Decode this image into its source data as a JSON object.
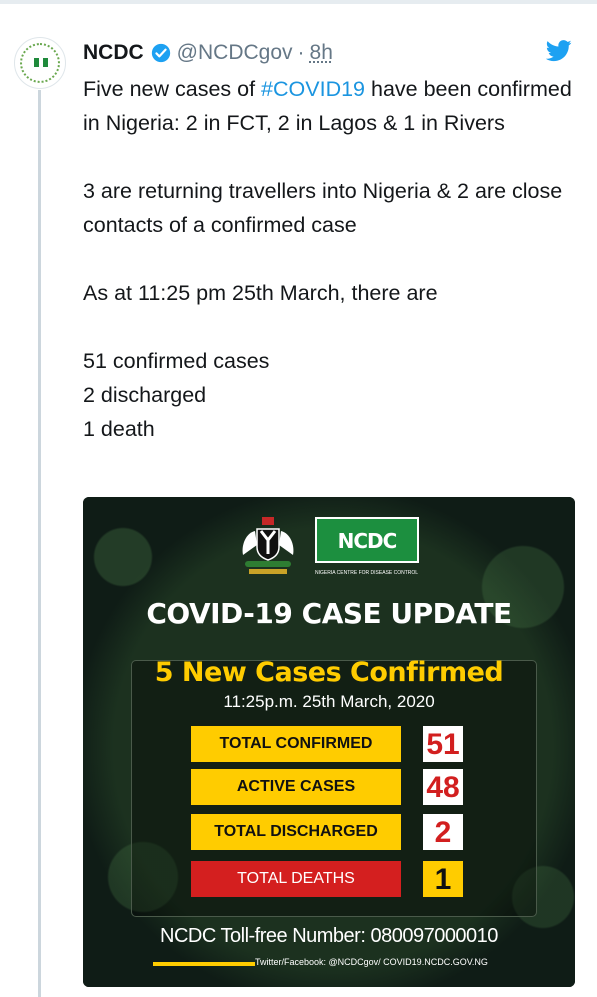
{
  "tweet": {
    "display_name": "NCDC",
    "handle": "@NCDCgov",
    "separator": "·",
    "time": "8h",
    "lines": [
      "Five new cases of ",
      "#COVID19",
      " have been confirmed in Nigeria: 2 in FCT, 2 in Lagos & 1 in Rivers",
      "3 are returning travellers into Nigeria & 2 are close contacts of a confirmed case",
      "As at 11:25 pm 25th March, there are",
      "51 confirmed cases",
      "2 discharged",
      "1 death"
    ]
  },
  "media": {
    "logo_text": "NCDC",
    "logo_subtitle": "NIGERIA CENTRE FOR DISEASE CONTROL",
    "title": "COVID-19 CASE UPDATE",
    "headline": "5 New Cases Confirmed",
    "timestamp": "11:25p.m. 25th March, 2020",
    "stats": [
      {
        "label": "TOTAL CONFIRMED",
        "value": "51"
      },
      {
        "label": "ACTIVE CASES",
        "value": "48"
      },
      {
        "label": "TOTAL DISCHARGED",
        "value": "2"
      },
      {
        "label": "TOTAL DEATHS",
        "value": "1"
      }
    ],
    "tollfree": "NCDC Toll-free Number: 080097000010",
    "social": "Twitter/Facebook: @NCDCgov/ COVID19.NCDC.GOV.NG"
  },
  "colors": {
    "link": "#1b95e0",
    "yellow": "#ffcc00",
    "red": "#d41f1f",
    "green": "#1c8f3f"
  }
}
